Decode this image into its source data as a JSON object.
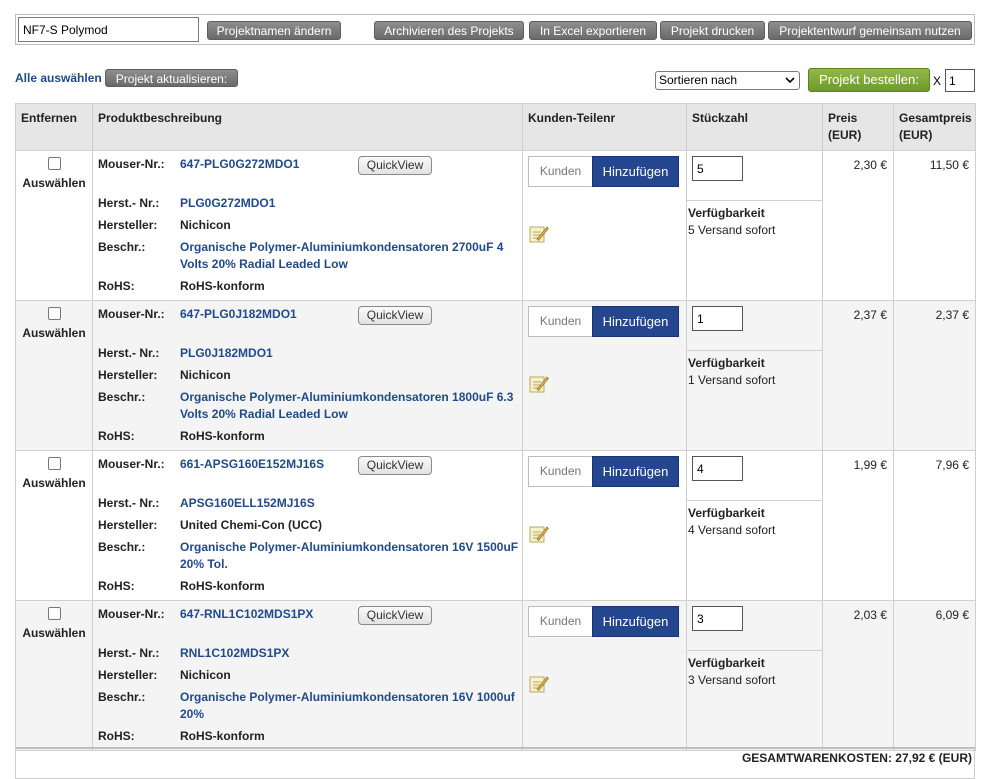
{
  "toolbar": {
    "project_name": "NF7-S Polymod",
    "rename_label": "Projektnamen ändern",
    "archive_label": "Archivieren des Projekts",
    "excel_label": "In Excel exportieren",
    "print_label": "Projekt drucken",
    "share_label": "Projektentwurf gemeinsam nutzen"
  },
  "actions": {
    "select_all": "Alle auswählen",
    "update_label": "Projekt aktualisieren:",
    "sort_label": "Sortieren nach",
    "order_label": "Projekt bestellen:",
    "multiplier_x": "X",
    "multiplier_value": "1"
  },
  "table": {
    "headers": {
      "remove": "Entfernen",
      "description": "Produktbeschreibung",
      "customer_part": "Kunden-Teilenr",
      "qty": "Stückzahl",
      "price": "Preis (EUR)",
      "total": "Gesamtpreis (EUR)"
    },
    "labels": {
      "select": "Auswählen",
      "mouser": "Mouser-Nr.:",
      "mfr_no": "Herst.- Nr.:",
      "mfr": "Hersteller:",
      "desc": "Beschr.:",
      "rohs": "RoHS:",
      "quickview": "QuickView",
      "customer_placeholder": "Kunden",
      "add": "Hinzufügen",
      "availability": "Verfügbarkeit"
    },
    "rows": [
      {
        "mouser_no": "647-PLG0G272MDO1",
        "mfr_no": "PLG0G272MDO1",
        "mfr": "Nichicon",
        "desc": "Organische Polymer-Aluminiumkondensatoren 2700uF 4 Volts 20% Radial Leaded Low",
        "rohs": "RoHS-konform",
        "qty": "5",
        "availability": "5 Versand sofort",
        "price": "2,30 €",
        "total": "11,50 €"
      },
      {
        "mouser_no": "647-PLG0J182MDO1",
        "mfr_no": "PLG0J182MDO1",
        "mfr": "Nichicon",
        "desc": "Organische Polymer-Aluminiumkondensatoren 1800uF 6.3 Volts 20% Radial Leaded Low",
        "rohs": "RoHS-konform",
        "qty": "1",
        "availability": "1 Versand sofort",
        "price": "2,37 €",
        "total": "2,37 €"
      },
      {
        "mouser_no": "661-APSG160E152MJ16S",
        "mfr_no": "APSG160ELL152MJ16S",
        "mfr": "United Chemi-Con (UCC)",
        "desc": "Organische Polymer-Aluminiumkondensatoren 16V 1500uF 20% Tol.",
        "rohs": "RoHS-konform",
        "qty": "4",
        "availability": "4 Versand sofort",
        "price": "1,99 €",
        "total": "7,96 €"
      },
      {
        "mouser_no": "647-RNL1C102MDS1PX",
        "mfr_no": "RNL1C102MDS1PX",
        "mfr": "Nichicon",
        "desc": "Organische Polymer-Aluminiumkondensatoren 16V 1000uf 20%",
        "rohs": "RoHS-konform",
        "qty": "3",
        "availability": "3 Versand sofort",
        "price": "2,03 €",
        "total": "6,09 €"
      }
    ]
  },
  "summary": {
    "total_text": "GESAMTWARENKOSTEN: 27,92 € (EUR)"
  },
  "icons": {
    "edit": "edit-note-icon",
    "dropdown": "chevron-down-icon"
  }
}
